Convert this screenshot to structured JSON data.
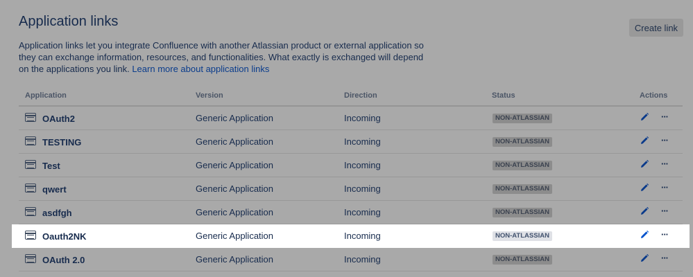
{
  "header": {
    "title": "Application links",
    "create_button": "Create link"
  },
  "description": {
    "text": "Application links let you integrate Confluence with another Atlassian product or external application so they can exchange information, resources, and functionalities. What exactly is exchanged will depend on the applications you link. ",
    "link": "Learn more about application links"
  },
  "table": {
    "columns": {
      "application": "Application",
      "version": "Version",
      "direction": "Direction",
      "status": "Status",
      "actions": "Actions"
    },
    "rows": [
      {
        "name": "OAuth2",
        "version": "Generic Application",
        "direction": "Incoming",
        "status": "NON-ATLASSIAN",
        "more": "···"
      },
      {
        "name": "TESTING",
        "version": "Generic Application",
        "direction": "Incoming",
        "status": "NON-ATLASSIAN",
        "more": "···"
      },
      {
        "name": "Test",
        "version": "Generic Application",
        "direction": "Incoming",
        "status": "NON-ATLASSIAN",
        "more": "···"
      },
      {
        "name": "qwert",
        "version": "Generic Application",
        "direction": "Incoming",
        "status": "NON-ATLASSIAN",
        "more": "···"
      },
      {
        "name": "asdfgh",
        "version": "Generic Application",
        "direction": "Incoming",
        "status": "NON-ATLASSIAN",
        "more": "···"
      },
      {
        "name": "Oauth2NK",
        "version": "Generic Application",
        "direction": "Incoming",
        "status": "NON-ATLASSIAN",
        "more": "···"
      },
      {
        "name": "OAuth 2.0",
        "version": "Generic Application",
        "direction": "Incoming",
        "status": "NON-ATLASSIAN",
        "more": "···"
      }
    ]
  },
  "colors": {
    "overlay_background": "#a9a9a9",
    "highlight_row": "#ffffff",
    "link": "#0052cc",
    "edit_icon": "#0747a6"
  },
  "icons": {
    "row_icon": "application-window-icon",
    "edit": "pencil-icon",
    "more": "more-horizontal-icon"
  }
}
